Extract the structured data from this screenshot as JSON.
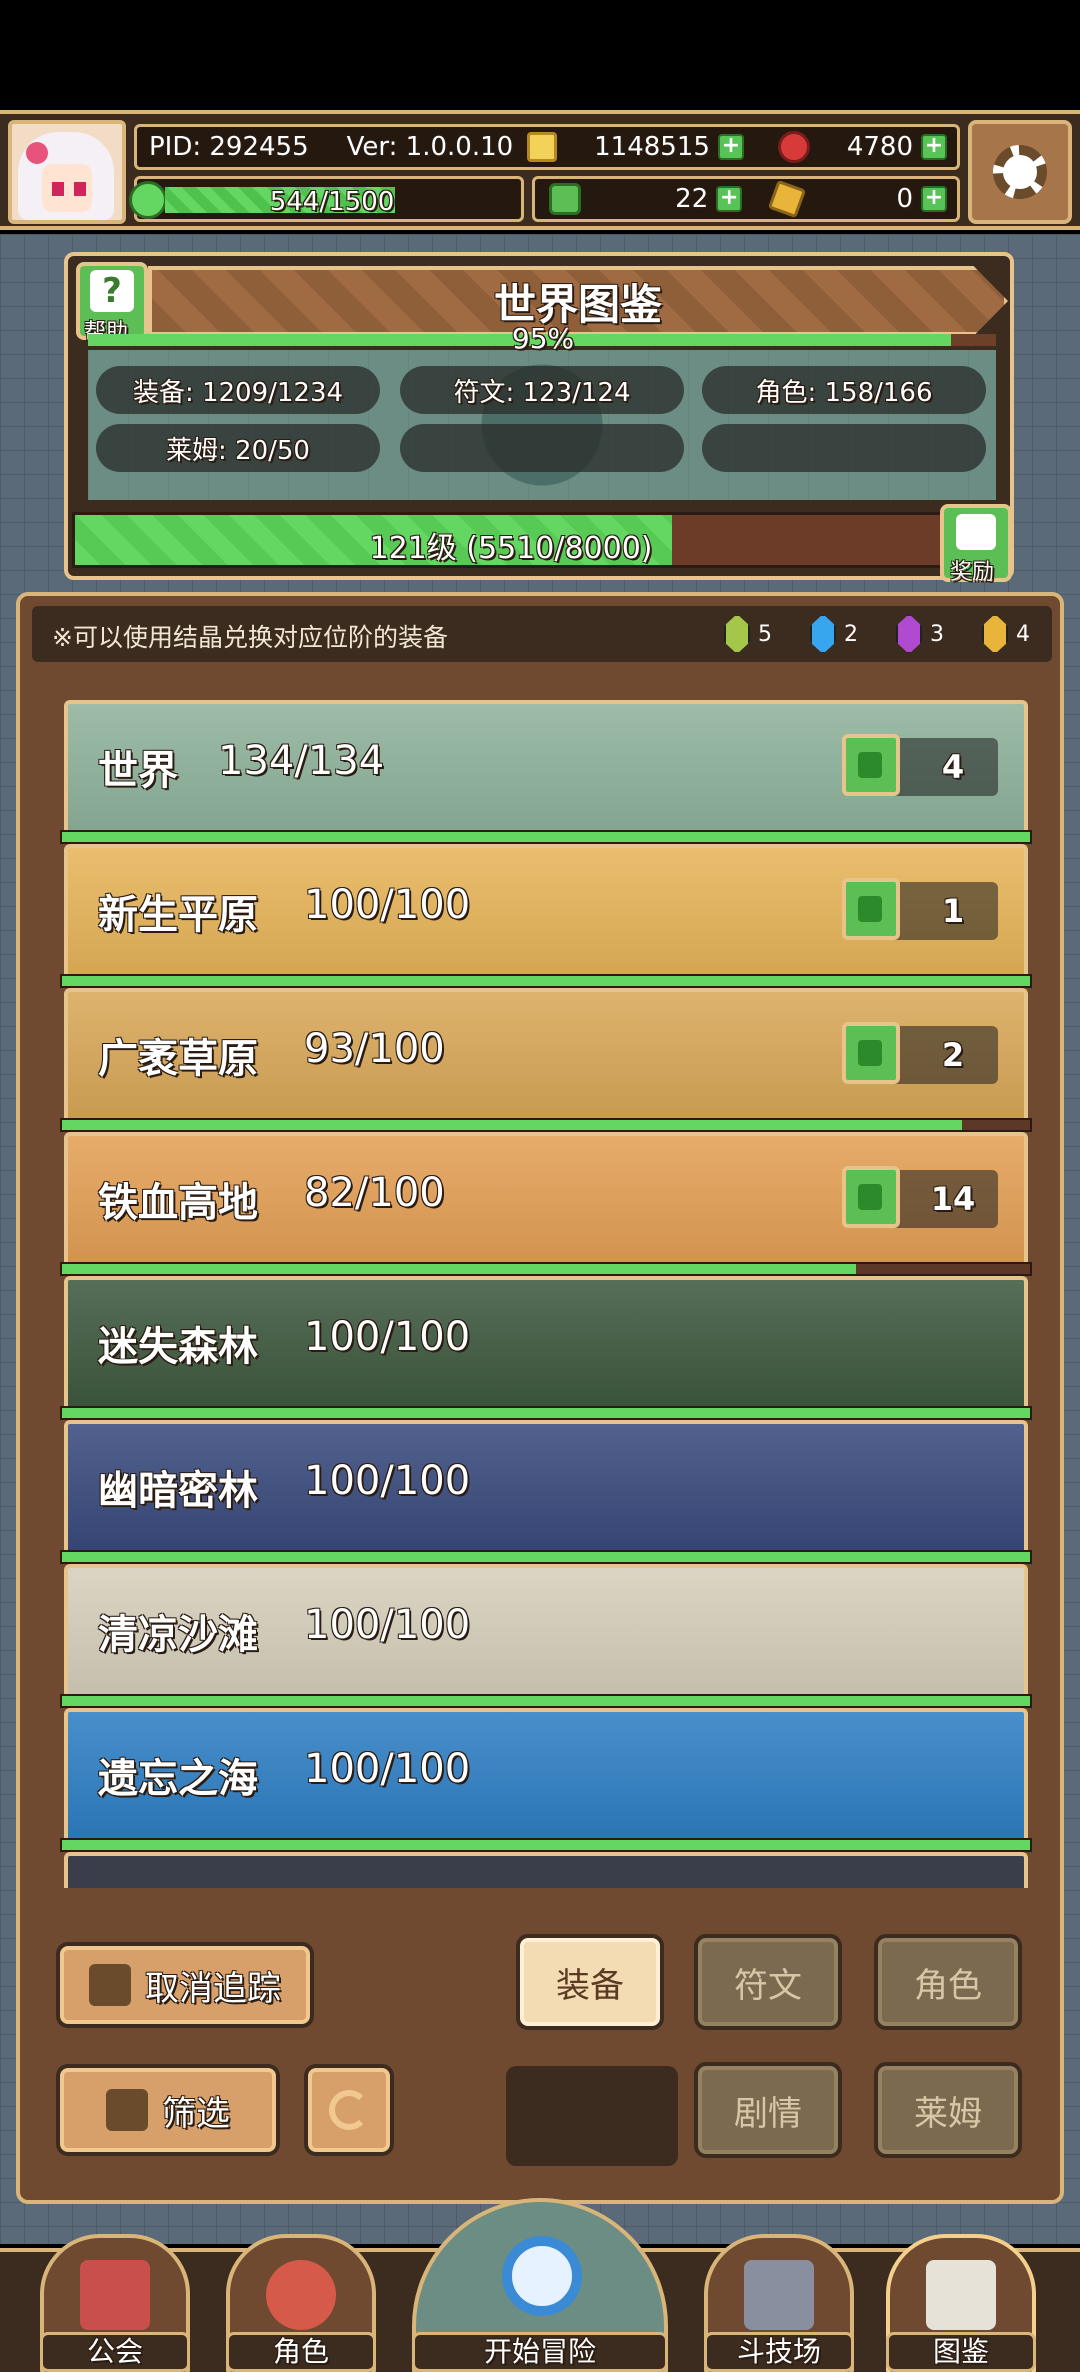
{
  "player": {
    "pid": "PID: 292455",
    "version": "Ver: 1.0.0.10",
    "stamina": "544/1500",
    "stamina_fraction": 0.3627
  },
  "currencies": {
    "gold": "1148515",
    "ruby": "4780",
    "clover": "22",
    "key": "0"
  },
  "codex": {
    "help_label": "帮助",
    "title": "世界图鉴",
    "completion_pct": "95%",
    "completion_fraction": 0.95,
    "stats": {
      "equipment": "装备: 1209/1234",
      "runes": "符文: 123/124",
      "characters": "角色: 158/166",
      "slimes": "莱姆: 20/50"
    },
    "level_text": "121级 (5510/8000)",
    "level_fraction": 0.689,
    "reward_label": "奖励"
  },
  "tip": {
    "text": "※可以使用结晶兑换对应位阶的装备",
    "crystals": [
      {
        "color": "#a4c64a",
        "count": "5"
      },
      {
        "color": "#38a6ee",
        "count": "2"
      },
      {
        "color": "#b04ad0",
        "count": "3"
      },
      {
        "color": "#e8b43a",
        "count": "4"
      }
    ]
  },
  "regions": [
    {
      "name": "世界",
      "progress": "134/134",
      "fraction": 1.0,
      "likes": "4",
      "bg": "#8fb39c"
    },
    {
      "name": "新生平原",
      "progress": "100/100",
      "fraction": 1.0,
      "likes": "1",
      "bg": "#e7b55a"
    },
    {
      "name": "广袤草原",
      "progress": "93/100",
      "fraction": 0.93,
      "likes": "2",
      "bg": "#d9a859"
    },
    {
      "name": "铁血高地",
      "progress": "82/100",
      "fraction": 0.82,
      "likes": "14",
      "bg": "#e4a056"
    },
    {
      "name": "迷失森林",
      "progress": "100/100",
      "fraction": 1.0,
      "likes": null,
      "bg": "#3f5a40"
    },
    {
      "name": "幽暗密林",
      "progress": "100/100",
      "fraction": 1.0,
      "likes": null,
      "bg": "#3a4b7d"
    },
    {
      "name": "清凉沙滩",
      "progress": "100/100",
      "fraction": 1.0,
      "likes": null,
      "bg": "#d6cfbc"
    },
    {
      "name": "遗忘之海",
      "progress": "100/100",
      "fraction": 1.0,
      "likes": null,
      "bg": "#2f7fc4"
    }
  ],
  "controls": {
    "untrack": "取消追踪",
    "filter": "筛选",
    "tabs": {
      "equipment": "装备",
      "runes": "符文",
      "characters": "角色",
      "story": "剧情",
      "slimes": "莱姆"
    }
  },
  "nav": {
    "guild": "公会",
    "character": "角色",
    "start": "开始冒险",
    "arena": "斗技场",
    "codex": "图鉴"
  }
}
